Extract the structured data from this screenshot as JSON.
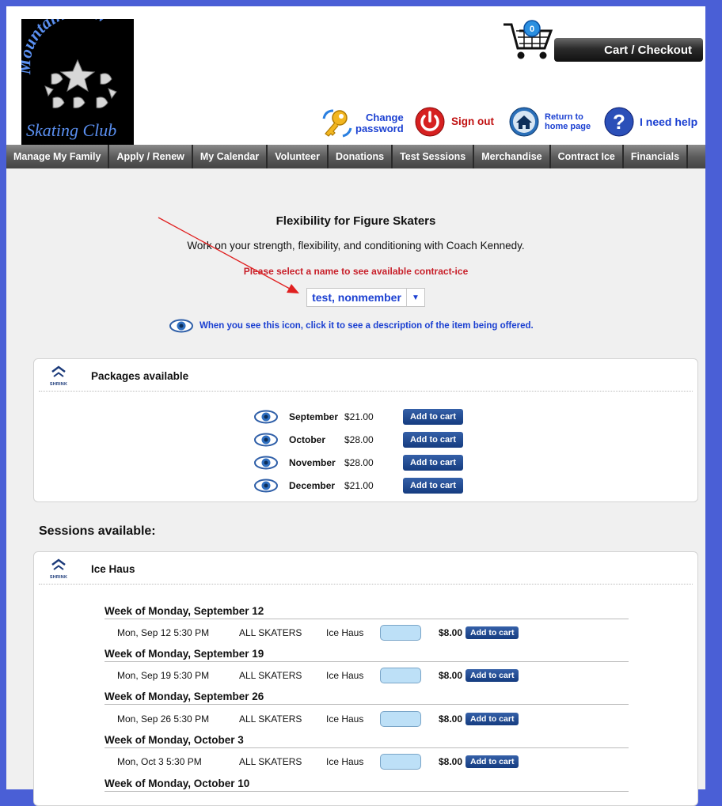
{
  "logo": {
    "text": "Mountain View Skating Club"
  },
  "cart": {
    "count": "0",
    "label": "Cart / Checkout"
  },
  "tools": {
    "change_password": [
      "Change",
      "password"
    ],
    "sign_out": "Sign out",
    "return_home": [
      "Return to",
      "home page"
    ],
    "help": "I need help"
  },
  "nav": [
    "Manage My Family",
    "Apply / Renew",
    "My Calendar",
    "Volunteer",
    "Donations",
    "Test Sessions",
    "Merchandise",
    "Contract Ice",
    "Financials"
  ],
  "page": {
    "title": "Flexibility for Figure Skaters",
    "subtitle": "Work on your strength, flexibility, and conditioning with Coach Kennedy.",
    "prompt": "Please select a name to see available contract-ice",
    "selected_name": "test, nonmember",
    "hint": "When you see this icon, click it to see a description of the item being offered."
  },
  "packages": {
    "title": "Packages available",
    "shrink": "SHRINK",
    "items": [
      {
        "month": "September",
        "price": "$21.00",
        "btn": "Add to cart"
      },
      {
        "month": "October",
        "price": "$28.00",
        "btn": "Add to cart"
      },
      {
        "month": "November",
        "price": "$28.00",
        "btn": "Add to cart"
      },
      {
        "month": "December",
        "price": "$21.00",
        "btn": "Add to cart"
      }
    ]
  },
  "sessions": {
    "label": "Sessions available:",
    "rink": "Ice Haus",
    "shrink": "SHRINK",
    "weeks": [
      {
        "title": "Week of Monday, September 12",
        "date": "Mon, Sep 12  5:30 PM",
        "group": "ALL SKATERS",
        "loc": "Ice Haus",
        "price": "$8.00",
        "btn": "Add to cart"
      },
      {
        "title": "Week of Monday, September 19",
        "date": "Mon, Sep 19  5:30 PM",
        "group": "ALL SKATERS",
        "loc": "Ice Haus",
        "price": "$8.00",
        "btn": "Add to cart"
      },
      {
        "title": "Week of Monday, September 26",
        "date": "Mon, Sep 26  5:30 PM",
        "group": "ALL SKATERS",
        "loc": "Ice Haus",
        "price": "$8.00",
        "btn": "Add to cart"
      },
      {
        "title": "Week of Monday, October 3",
        "date": "Mon, Oct 3  5:30 PM",
        "group": "ALL SKATERS",
        "loc": "Ice Haus",
        "price": "$8.00",
        "btn": "Add to cart"
      },
      {
        "title": "Week of Monday, October 10"
      }
    ]
  },
  "colors": {
    "page_bg": "#4a5fd6",
    "link_blue": "#1a3fd1",
    "prompt_red": "#c8202a",
    "button_blue": "#1f4a94",
    "annotation_arrow": "#e02020"
  }
}
